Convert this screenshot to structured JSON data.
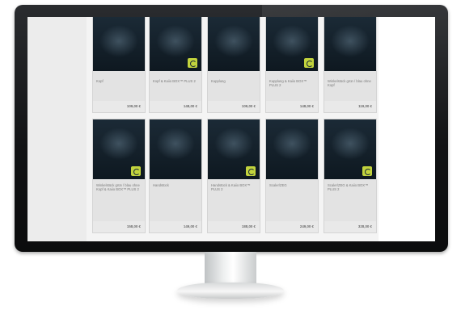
{
  "products": [
    {
      "name": "Kopf",
      "price": "109,00 €",
      "badge": false
    },
    {
      "name": "Kopf & Kaiio BOX™ PLUS 2",
      "price": "148,00 €",
      "badge": true
    },
    {
      "name": "Kupplung",
      "price": "109,00 €",
      "badge": false
    },
    {
      "name": "Kupplung & Kaiio BOX™ PLUS 2",
      "price": "148,00 €",
      "badge": true
    },
    {
      "name": "Winkelstück grün / blau ohne Kopf",
      "price": "119,00 €",
      "badge": false
    },
    {
      "name": "Winkelstück grün / blau ohne Kopf & Kaiio BOX™ PLUS 2",
      "price": "158,00 €",
      "badge": true
    },
    {
      "name": "Handstück",
      "price": "149,00 €",
      "badge": false
    },
    {
      "name": "Handstück & Kaiio BOX™ PLUS 2",
      "price": "188,00 €",
      "badge": true
    },
    {
      "name": "Scaler/ZEG",
      "price": "249,00 €",
      "badge": false
    },
    {
      "name": "Scaler/ZEG & Kaiio BOX™ PLUS 2",
      "price": "328,00 €",
      "badge": true
    }
  ]
}
